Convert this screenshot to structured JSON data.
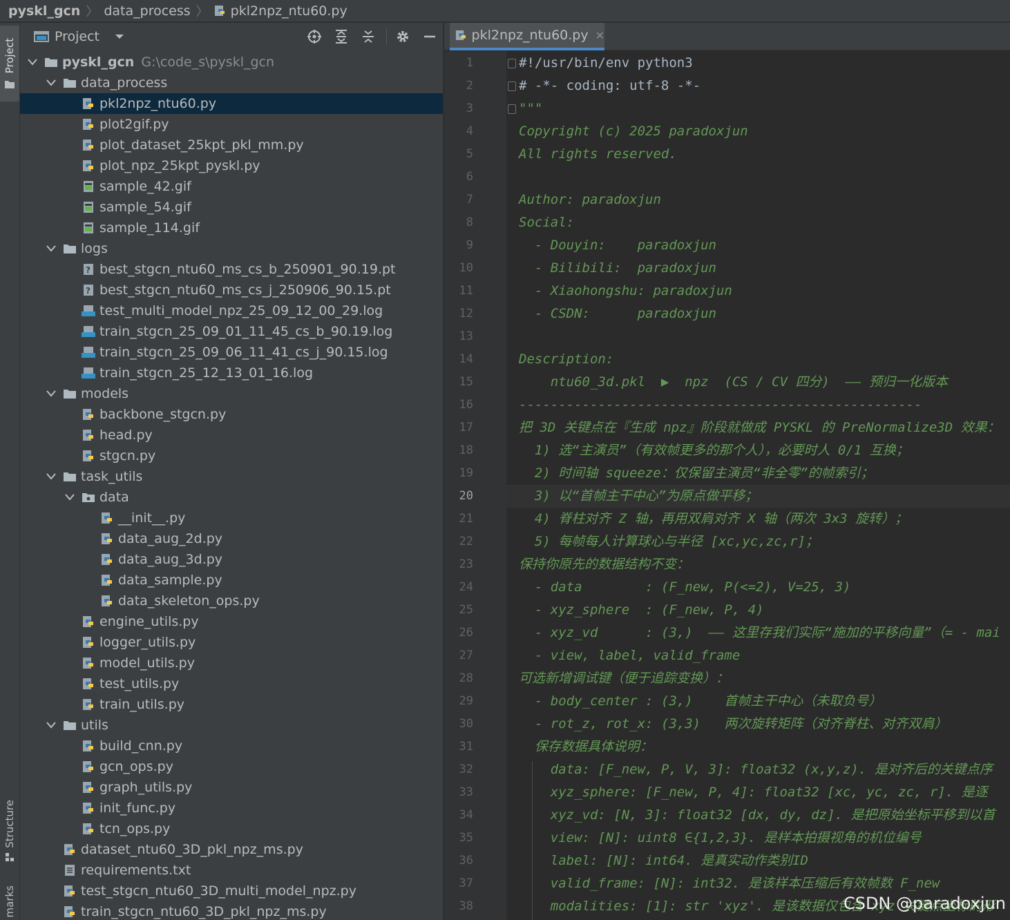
{
  "breadcrumb": {
    "items": [
      "pyskl_gcn",
      "data_process",
      "pkl2npz_ntu60.py"
    ]
  },
  "tool_window": {
    "project_tab": "Project",
    "structure_tab": "Structure",
    "bookmarks_tab": "marks"
  },
  "project_panel": {
    "title": "Project"
  },
  "tree": [
    {
      "label": "pyskl_gcn",
      "path": "G:\\code_s\\pyskl_gcn",
      "type": "root",
      "depth": 0
    },
    {
      "label": "data_process",
      "type": "folder",
      "depth": 1
    },
    {
      "label": "pkl2npz_ntu60.py",
      "type": "py",
      "depth": 2,
      "selected": true
    },
    {
      "label": "plot2gif.py",
      "type": "py",
      "depth": 2
    },
    {
      "label": "plot_dataset_25kpt_pkl_mm.py",
      "type": "py",
      "depth": 2
    },
    {
      "label": "plot_npz_25kpt_pyskl.py",
      "type": "py",
      "depth": 2
    },
    {
      "label": "sample_42.gif",
      "type": "gif",
      "depth": 2
    },
    {
      "label": "sample_54.gif",
      "type": "gif",
      "depth": 2
    },
    {
      "label": "sample_114.gif",
      "type": "gif",
      "depth": 2
    },
    {
      "label": "logs",
      "type": "folder",
      "depth": 1
    },
    {
      "label": "best_stgcn_ntu60_ms_cs_b_250901_90.19.pt",
      "type": "unknown",
      "depth": 2
    },
    {
      "label": "best_stgcn_ntu60_ms_cs_j_250906_90.15.pt",
      "type": "unknown",
      "depth": 2
    },
    {
      "label": "test_multi_model_npz_25_09_12_00_29.log",
      "type": "log",
      "depth": 2
    },
    {
      "label": "train_stgcn_25_09_01_11_45_cs_b_90.19.log",
      "type": "log",
      "depth": 2
    },
    {
      "label": "train_stgcn_25_09_06_11_41_cs_j_90.15.log",
      "type": "log",
      "depth": 2
    },
    {
      "label": "train_stgcn_25_12_13_01_16.log",
      "type": "log",
      "depth": 2
    },
    {
      "label": "models",
      "type": "folder",
      "depth": 1
    },
    {
      "label": "backbone_stgcn.py",
      "type": "py",
      "depth": 2
    },
    {
      "label": "head.py",
      "type": "py",
      "depth": 2
    },
    {
      "label": "stgcn.py",
      "type": "py",
      "depth": 2
    },
    {
      "label": "task_utils",
      "type": "folder",
      "depth": 1
    },
    {
      "label": "data",
      "type": "package",
      "depth": 2
    },
    {
      "label": "__init__.py",
      "type": "py",
      "depth": 3
    },
    {
      "label": "data_aug_2d.py",
      "type": "py",
      "depth": 3
    },
    {
      "label": "data_aug_3d.py",
      "type": "py",
      "depth": 3
    },
    {
      "label": "data_sample.py",
      "type": "py",
      "depth": 3
    },
    {
      "label": "data_skeleton_ops.py",
      "type": "py",
      "depth": 3
    },
    {
      "label": "engine_utils.py",
      "type": "py",
      "depth": 2
    },
    {
      "label": "logger_utils.py",
      "type": "py",
      "depth": 2
    },
    {
      "label": "model_utils.py",
      "type": "py",
      "depth": 2
    },
    {
      "label": "test_utils.py",
      "type": "py",
      "depth": 2
    },
    {
      "label": "train_utils.py",
      "type": "py",
      "depth": 2
    },
    {
      "label": "utils",
      "type": "folder",
      "depth": 1
    },
    {
      "label": "build_cnn.py",
      "type": "py",
      "depth": 2
    },
    {
      "label": "gcn_ops.py",
      "type": "py",
      "depth": 2
    },
    {
      "label": "graph_utils.py",
      "type": "py",
      "depth": 2
    },
    {
      "label": "init_func.py",
      "type": "py",
      "depth": 2
    },
    {
      "label": "tcn_ops.py",
      "type": "py",
      "depth": 2
    },
    {
      "label": "dataset_ntu60_3D_pkl_npz_ms.py",
      "type": "py",
      "depth": 1
    },
    {
      "label": "requirements.txt",
      "type": "txt",
      "depth": 1
    },
    {
      "label": "test_stgcn_ntu60_3D_multi_model_npz.py",
      "type": "py",
      "depth": 1
    },
    {
      "label": "train_stgcn_ntu60_3D_pkl_npz_ms.py",
      "type": "py",
      "depth": 1
    }
  ],
  "editor": {
    "tab_label": "pkl2npz_ntu60.py",
    "current_line": 20,
    "lines": [
      "#!/usr/bin/env python3",
      "# -*- coding: utf-8 -*-",
      "\"\"\"",
      "Copyright (c) 2025 paradoxjun",
      "All rights reserved.",
      "",
      "Author: paradoxjun",
      "Social:",
      "  - Douyin:    paradoxjun",
      "  - Bilibili:  paradoxjun",
      "  - Xiaohongshu: paradoxjun",
      "  - CSDN:      paradoxjun",
      "",
      "Description:",
      "    ntu60_3d.pkl  ▶  npz  (CS / CV 四分)  —— 预归一化版本",
      "---------------------------------------------------",
      "把 3D 关键点在『生成 npz』阶段就做成 PYSKL 的 PreNormalize3D 效果：",
      "  1) 选“主演员”（有效帧更多的那个人），必要时人 0/1 互换；",
      "  2) 时间轴 squeeze：仅保留主演员“非全零”的帧索引；",
      "  3) 以“首帧主干中心”为原点做平移；",
      "  4) 脊柱对齐 Z 轴，再用双肩对齐 X 轴（两次 3x3 旋转）；",
      "  5) 每帧每人计算球心与半径 [xc,yc,zc,r]；",
      "保持你原先的数据结构不变：",
      "  - data        : (F_new, P(<=2), V=25, 3)",
      "  - xyz_sphere  : (F_new, P, 4)",
      "  - xyz_vd      : (3,)  —— 这里存我们实际“施加的平移向量”（= - mai",
      "  - view, label, valid_frame",
      "可选新增调试键（便于追踪变换）：",
      "  - body_center : (3,)    首帧主干中心（未取负号）",
      "  - rot_z, rot_x: (3,3)   两次旋转矩阵（对齐脊柱、对齐双肩）",
      "  保存数据具体说明：",
      "    data: [F_new, P, V, 3]: float32 (x,y,z). 是对齐后的关键点序",
      "    xyz_sphere: [F_new, P, 4]: float32 [xc, yc, zc, r]. 是逐",
      "    xyz_vd: [N, 3]: float32 [dx, dy, dz]. 是把原始坐标平移到以首",
      "    view: [N]: uint8 ∈{1,2,3}. 是样本拍摄视角的机位编号",
      "    label: [N]: int64. 是真实动作类别ID",
      "    valid_frame: [N]: int32. 是该样本压缩后有效帧数 F_new",
      "    modalities: [1]: str 'xyz'. 是该数据仅包含 xyz 关键点坐标的形"
    ]
  },
  "watermark": "CSDN @paradoxjun",
  "colors": {
    "background": "#2b2b2b",
    "panel": "#3c3f41",
    "selection": "#0d293e",
    "docstring": "#629755",
    "code": "#a9b7c6",
    "line_number": "#606366"
  }
}
